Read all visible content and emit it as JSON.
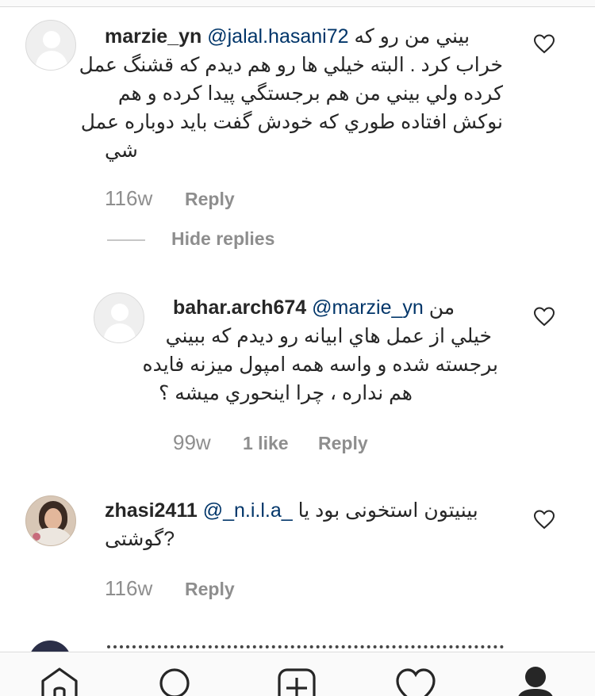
{
  "comments": [
    {
      "username": "marzie_yn",
      "mention": "@jalal.hasani72",
      "first_line_text": "بيني من رو که",
      "lines": [
        "خراب کرد . البته خيلي ها رو هم ديدم که قشنگ عمل",
        "کرده ولي بيني من هم برجستگي پيدا کرده و هم",
        "نوکش افتاده طوري که خودش گفت بايد دوباره عمل",
        "شي"
      ],
      "time": "116w",
      "reply_label": "Reply"
    },
    {
      "username": "bahar.arch674",
      "mention": "@marzie_yn",
      "first_line_text": "من",
      "lines": [
        "خيلي از عمل هاي ابيانه رو ديدم که ببيني",
        "برجسته شده و واسه همه امپول ميزنه فايده",
        "هم نداره ، چرا اينحوري ميشه ؟"
      ],
      "time": "99w",
      "likes_label": "1 like",
      "reply_label": "Reply"
    },
    {
      "username": "zhasi2411",
      "mention": "@_n.i.l.a_",
      "first_line_text": "بینیتون استخونی بود یا",
      "lines": [
        "گوشتی?"
      ],
      "time": "116w",
      "reply_label": "Reply"
    }
  ],
  "hide_replies_label": "Hide replies",
  "tab_bar": {
    "items": [
      "home-icon",
      "search-icon",
      "new-post-icon",
      "activity-heart-icon",
      "profile-icon"
    ]
  },
  "colors": {
    "text": "#262626",
    "mention": "#003569",
    "meta": "#8e8e8e",
    "divider": "#dbdbdb"
  }
}
